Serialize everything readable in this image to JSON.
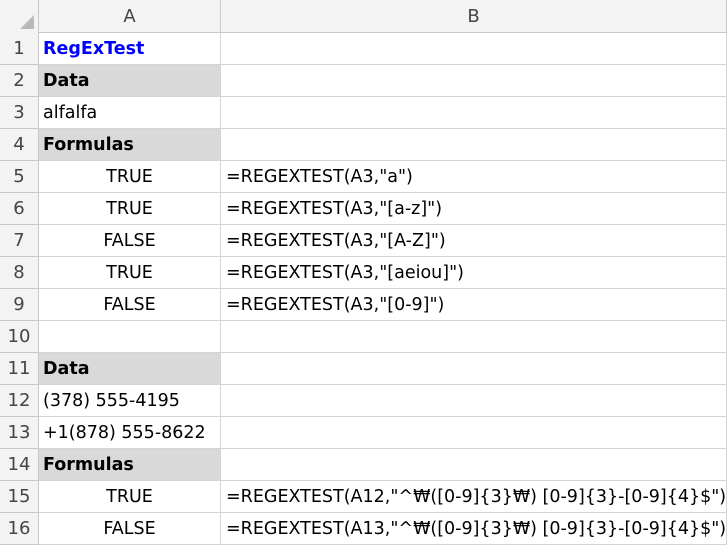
{
  "sheet": {
    "columns": [
      "A",
      "B"
    ],
    "rows": [
      {
        "num": "1",
        "a": "RegExTest",
        "b": "",
        "style": "title"
      },
      {
        "num": "2",
        "a": "Data",
        "b": "",
        "style": "section"
      },
      {
        "num": "3",
        "a": "alfalfa",
        "b": "",
        "style": "text"
      },
      {
        "num": "4",
        "a": "Formulas",
        "b": "",
        "style": "section"
      },
      {
        "num": "5",
        "a": "TRUE",
        "b": "=REGEXTEST(A3,\"a\")",
        "style": "bool"
      },
      {
        "num": "6",
        "a": "TRUE",
        "b": "=REGEXTEST(A3,\"[a-z]\")",
        "style": "bool"
      },
      {
        "num": "7",
        "a": "FALSE",
        "b": "=REGEXTEST(A3,\"[A-Z]\")",
        "style": "bool"
      },
      {
        "num": "8",
        "a": "TRUE",
        "b": "=REGEXTEST(A3,\"[aeiou]\")",
        "style": "bool"
      },
      {
        "num": "9",
        "a": "FALSE",
        "b": "=REGEXTEST(A3,\"[0-9]\")",
        "style": "bool"
      },
      {
        "num": "10",
        "a": "",
        "b": "",
        "style": "text"
      },
      {
        "num": "11",
        "a": "Data",
        "b": "",
        "style": "section"
      },
      {
        "num": "12",
        "a": "(378) 555-4195",
        "b": "",
        "style": "text"
      },
      {
        "num": "13",
        "a": "+1(878) 555-8622",
        "b": "",
        "style": "text"
      },
      {
        "num": "14",
        "a": "Formulas",
        "b": "",
        "style": "section"
      },
      {
        "num": "15",
        "a": "TRUE",
        "b": "=REGEXTEST(A12,\"^₩([0-9]{3}₩) [0-9]{3}-[0-9]{4}$\")",
        "style": "bool"
      },
      {
        "num": "16",
        "a": "FALSE",
        "b": "=REGEXTEST(A13,\"^₩([0-9]{3}₩) [0-9]{3}-[0-9]{4}$\")",
        "style": "bool"
      }
    ]
  },
  "colors": {
    "header_bg": "#f3f3f3",
    "section_bg": "#d9d9d9",
    "title_text": "#0000ff",
    "gridline": "#d4d4d4"
  }
}
